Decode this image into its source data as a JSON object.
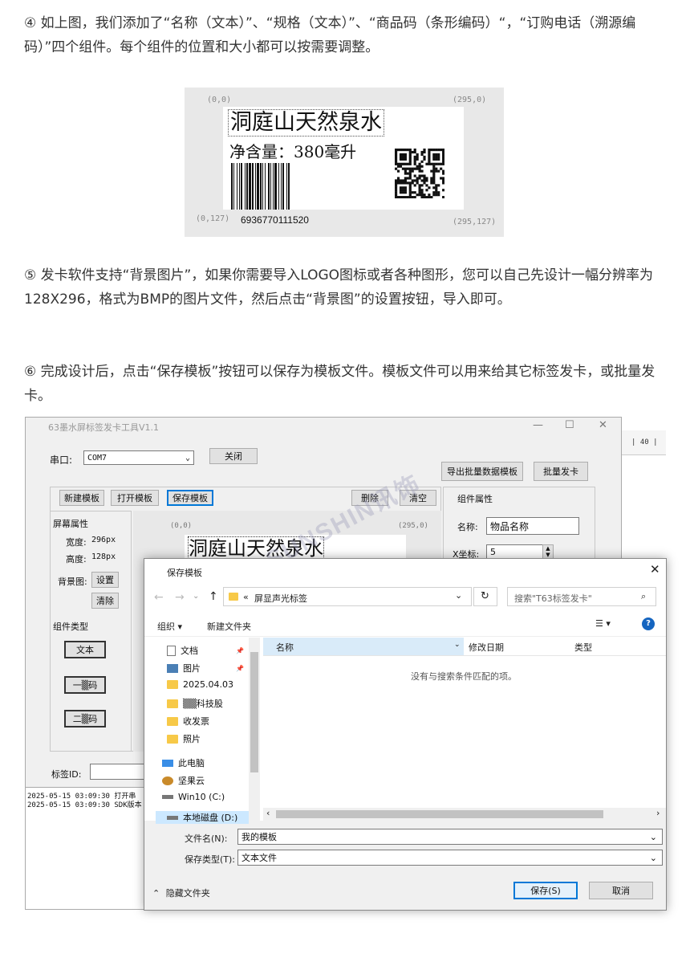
{
  "paragraphs": {
    "p4": "④ 如上图，我们添加了“名称（文本）”、“规格（文本）”、“商品码（条形编码）“，“订购电话（溯源编码）”四个组件。每个组件的位置和大小都可以按需要调整。",
    "p5": "⑤ 发卡软件支持“背景图片”，如果你需要导入LOGO图标或者各种图形，您可以自己先设计一幅分辨率为128X296，格式为BMP的图片文件，然后点击“背景图”的设置按钮，导入即可。",
    "p6": "⑥ 完成设计后，点击“保存模板”按钮可以保存为模板文件。模板文件可以用来给其它标签发卡，或批量发卡。"
  },
  "label_preview": {
    "coord_tl": "(0,0)",
    "coord_tr": "(295,0)",
    "coord_bl": "(0,127)",
    "coord_br": "(295,127)",
    "title": "洞庭山天然泉水",
    "spec": "净含量：380毫升",
    "barcode_number": "6936770111520"
  },
  "app": {
    "title": "63墨水屏标签发卡工具V1.1",
    "port_label": "串口:",
    "port_value": "COM7",
    "close_port": "关闭",
    "export_batch": "导出批量数据模板",
    "batch_issue": "批量发卡",
    "new_template": "新建模板",
    "open_template": "打开模板",
    "save_template": "保存模板",
    "delete": "删除",
    "clear": "清空",
    "component_props": "组件属性",
    "screen_props": "屏幕属性",
    "width_label": "宽度:",
    "width_value": "296px",
    "height_label": "高度:",
    "height_value": "128px",
    "bg_label": "背景图:",
    "bg_set": "设置",
    "bg_clear": "清除",
    "comp_type": "组件类型",
    "btn_text": "文本",
    "btn_barcode": "一▒码",
    "btn_qrcode": "二▒码",
    "tag_id_label": "标签ID:",
    "canvas_coord_tl": "(0,0)",
    "canvas_coord_tr": "(295,0)",
    "canvas_title": "洞庭山天然泉水",
    "name_label": "名称:",
    "name_value": "物品名称",
    "x_label": "X坐标:",
    "x_value": "5",
    "log1": "2025-05-15 03:09:30 打开串",
    "log2": "2025-05-15 03:09:30 SDK版本",
    "ruler_text": "| 40 |"
  },
  "dialog": {
    "title": "保存模板",
    "path_prefix": "«",
    "path": "屏显声光标签",
    "search_placeholder": "搜索\"T63标签发卡\"",
    "organize": "组织 ▾",
    "new_folder": "新建文件夹",
    "col_name": "名称",
    "col_date": "修改日期",
    "col_type": "类型",
    "empty_msg": "没有与搜索条件匹配的项。",
    "nav_items": [
      "文档",
      "图片",
      "2025.04.03",
      "▒▒科技股",
      "收发票",
      "照片",
      "此电脑",
      "坚果云",
      "Win10 (C:)",
      "本地磁盘 (D:)"
    ],
    "filename_label": "文件名(N):",
    "filename_value": "我的模板",
    "filetype_label": "保存类型(T):",
    "filetype_value": "文本文件",
    "hide_folders": "隐藏文件夹",
    "save": "保存(S)",
    "cancel": "取消"
  },
  "watermark": "SUNSHIN讯饰"
}
